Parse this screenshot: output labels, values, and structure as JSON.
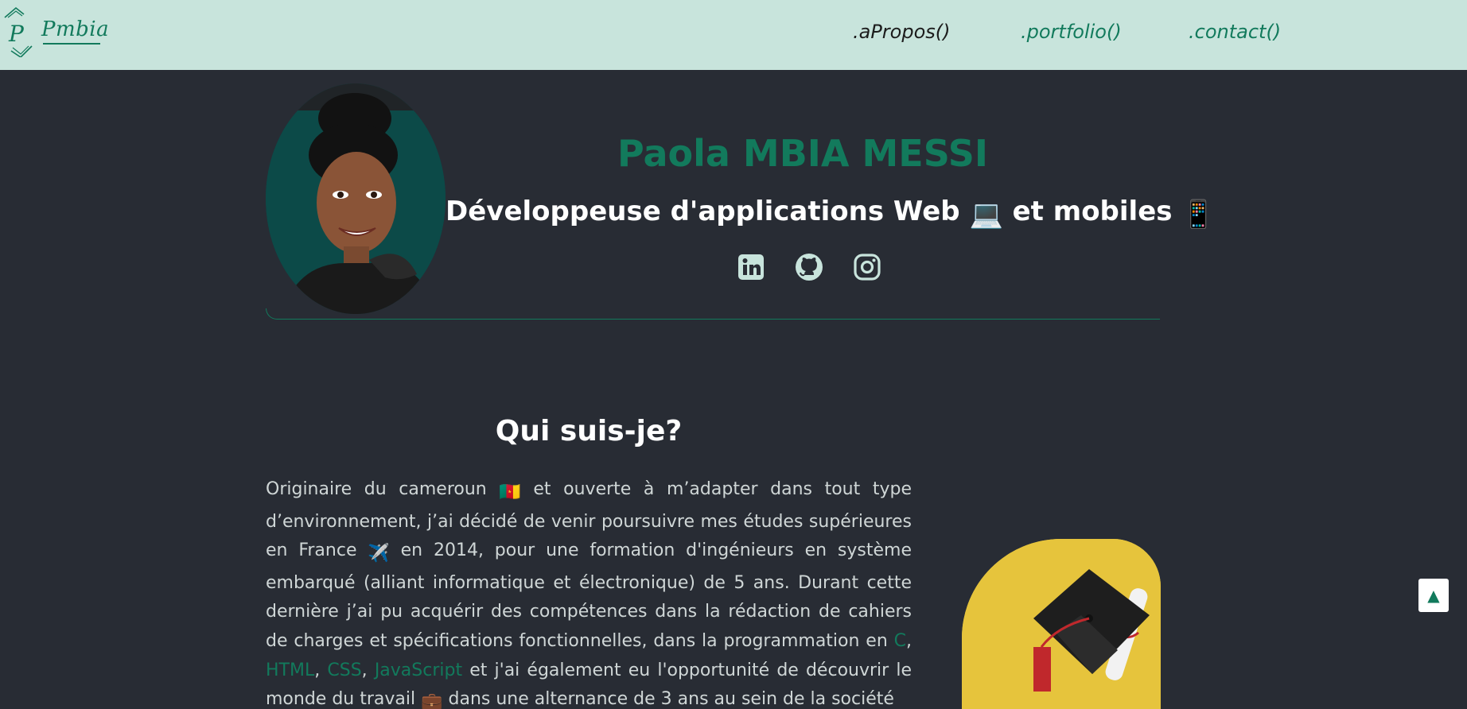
{
  "header": {
    "logo_text": "Pmbia",
    "nav": [
      {
        "label": ".aPropos()"
      },
      {
        "label": ".portfolio()"
      },
      {
        "label": ".contact()"
      }
    ]
  },
  "hero": {
    "name": "Paola MBIA MESSI",
    "title_part1": "Développeuse d'applications Web ",
    "title_emoji1": "💻",
    "title_part2": " et mobiles ",
    "title_emoji2": "📱",
    "socials": [
      "linkedin-icon",
      "github-icon",
      "instagram-icon"
    ]
  },
  "about": {
    "heading": "Qui suis-je?",
    "p1": "Originaire du cameroun ",
    "flag": "🇨🇲",
    "p2": " et ouverte à m’adapter dans tout type d’environnement, j’ai décidé de venir poursuivre mes études supérieures en France ",
    "plane": "✈️",
    "p3": " en 2014, pour une formation d'ingénieurs en système embarqué (alliant informatique et électronique) de 5 ans. Durant cette dernière j’ai pu acquérir des compétences dans la rédaction de cahiers de charges et spécifications fonctionnelles, dans la programmation en ",
    "lang_c": "C",
    "sep1": ", ",
    "lang_html": "HTML",
    "sep2": ", ",
    "lang_css": "CSS",
    "sep3": ", ",
    "lang_js": "JavaScript",
    "p4": " et j'ai également eu l'opportunité de découvrir le monde du travail ",
    "briefcase": "💼",
    "p5": " dans une alternance de 3 ans au sein de la société"
  },
  "scroll_top": {
    "label": "▲"
  },
  "colors": {
    "accent": "#127a5c",
    "navbar": "#c8e4dc",
    "background": "#282c34"
  }
}
